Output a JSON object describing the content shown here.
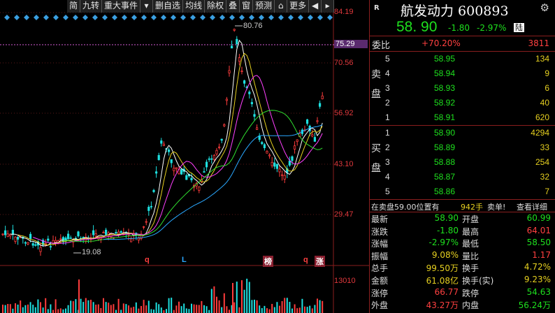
{
  "toolbar": {
    "items": [
      "简",
      "九转",
      "重大事件",
      "▾",
      "删自选",
      "均线",
      "除权",
      "叠",
      "窗",
      "预测",
      "⌂",
      "更多",
      "◀",
      "▸"
    ]
  },
  "chart": {
    "y_labels": [
      "84.19",
      "75.29",
      "70.56",
      "56.92",
      "43.10",
      "29.47",
      "13010"
    ],
    "high_label": "80.76",
    "low_label": "19.08",
    "markers": [
      "q",
      "L",
      "榜",
      "q",
      "涨"
    ]
  },
  "colors": {
    "up": "#ff3c3c",
    "down": "#1ee01e",
    "accent_volume": "#e6d020",
    "border": "#8a1e1e"
  },
  "quote": {
    "badge": "R",
    "name": "航发动力 600893",
    "price": "58. 90",
    "change": "-1.80",
    "change_pct": "-2.97%",
    "market_badge": "陆",
    "weibi_label": "委比",
    "weibi_pct": "+70.20%",
    "weibi_diff": "3811",
    "sell_label": [
      "卖",
      "盘"
    ],
    "buy_label": [
      "买",
      "盘"
    ],
    "sells": [
      {
        "idx": "5",
        "price": "58.95",
        "vol": "134"
      },
      {
        "idx": "4",
        "price": "58.94",
        "vol": "9"
      },
      {
        "idx": "3",
        "price": "58.93",
        "vol": "6"
      },
      {
        "idx": "2",
        "price": "58.92",
        "vol": "40"
      },
      {
        "idx": "1",
        "price": "58.91",
        "vol": "620"
      }
    ],
    "buys": [
      {
        "idx": "1",
        "price": "58.90",
        "vol": "4294"
      },
      {
        "idx": "2",
        "price": "58.89",
        "vol": "33"
      },
      {
        "idx": "3",
        "price": "58.88",
        "vol": "254"
      },
      {
        "idx": "4",
        "price": "58.87",
        "vol": "32"
      },
      {
        "idx": "5",
        "price": "58.86",
        "vol": "7"
      }
    ],
    "info_text": "在卖盘59.00位置有",
    "info_vol": "942手",
    "info_side": "卖单!",
    "info_link": "查看详细",
    "stats": [
      {
        "l": "最新",
        "v": "58.90",
        "vc": "#1ee01e",
        "l2": "开盘",
        "v2": "60.99",
        "v2c": "#1ee01e"
      },
      {
        "l": "涨跌",
        "v": "-1.80",
        "vc": "#1ee01e",
        "l2": "最高",
        "v2": "64.01",
        "v2c": "#ff4040"
      },
      {
        "l": "涨幅",
        "v": "-2.97%",
        "vc": "#1ee01e",
        "l2": "最低",
        "v2": "58.50",
        "v2c": "#1ee01e"
      },
      {
        "l": "振幅",
        "v": "9.08%",
        "vc": "#e6d020",
        "l2": "量比",
        "v2": "1.17",
        "v2c": "#ff4040"
      },
      {
        "l": "总手",
        "v": "99.50万",
        "vc": "#e6d020",
        "l2": "换手",
        "v2": "4.72%",
        "v2c": "#e6d020"
      },
      {
        "l": "金额",
        "v": "61.08亿",
        "vc": "#e6d020",
        "l2": "换手(实)",
        "v2": "9.23%",
        "v2c": "#e6d020"
      },
      {
        "l": "涨停",
        "v": "66.77",
        "vc": "#ff4040",
        "l2": "跌停",
        "v2": "54.63",
        "v2c": "#1ee01e"
      },
      {
        "l": "外盘",
        "v": "43.27万",
        "vc": "#ff4040",
        "l2": "内盘",
        "v2": "56.24万",
        "v2c": "#1ee01e"
      }
    ]
  }
}
